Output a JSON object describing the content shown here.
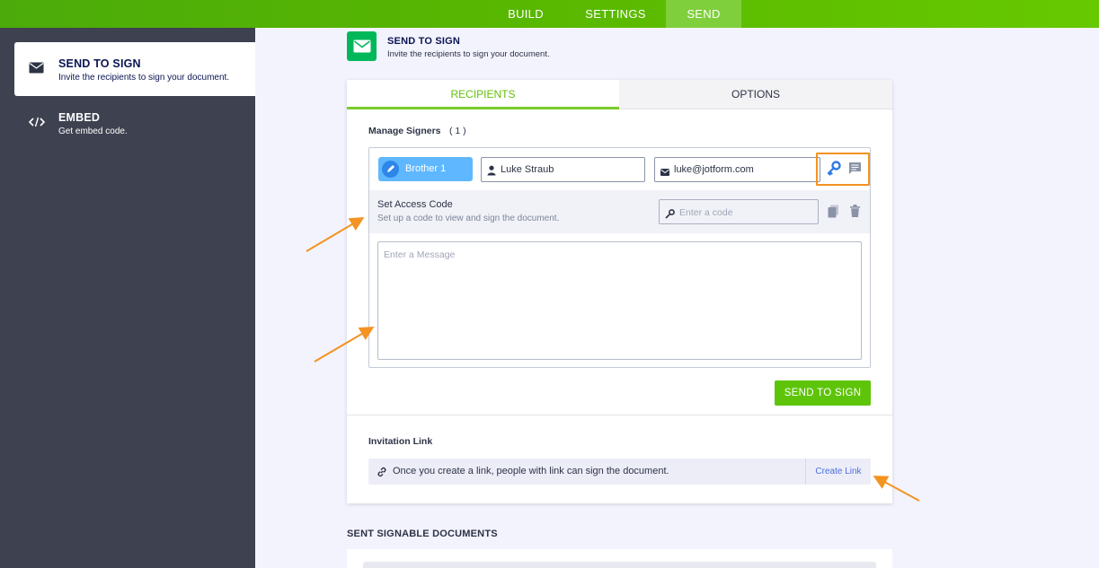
{
  "topnav": {
    "tabs": [
      {
        "label": "BUILD"
      },
      {
        "label": "SETTINGS"
      },
      {
        "label": "SEND"
      }
    ],
    "active_color": "#7fcf3c"
  },
  "sidebar": {
    "items": [
      {
        "title": "SEND TO SIGN",
        "subtitle": "Invite the recipients to sign your document.",
        "icon": "envelope-icon",
        "active": true
      },
      {
        "title": "EMBED",
        "subtitle": "Get embed code.",
        "icon": "code-icon",
        "active": false
      }
    ]
  },
  "header": {
    "title": "SEND TO SIGN",
    "subtitle": "Invite the recipients to sign your document.",
    "icon": "envelope-icon",
    "icon_color": "#00b85a"
  },
  "card": {
    "tabs": {
      "recipients": "RECIPIENTS",
      "options": "OPTIONS"
    },
    "manage_signers": {
      "label": "Manage Signers",
      "count": "( 1 )"
    },
    "signer": {
      "role": "Brother 1",
      "name": "Luke Straub",
      "email": "luke@jotform.com"
    },
    "access_code": {
      "title": "Set Access Code",
      "subtitle": "Set up a code to view and sign the document.",
      "placeholder": "Enter a code"
    },
    "message": {
      "placeholder": "Enter a Message"
    },
    "send_button": "SEND TO SIGN",
    "invitation": {
      "label": "Invitation Link",
      "text": "Once you create a link, people with link can sign the document.",
      "create_link": "Create Link"
    }
  },
  "sent_section": {
    "title": "SENT SIGNABLE DOCUMENTS"
  },
  "colors": {
    "accent_green": "#5ec40a",
    "highlight_orange": "#f39321",
    "role_chip": "#5fb8ff",
    "sidebar_bg": "#3e4150"
  }
}
